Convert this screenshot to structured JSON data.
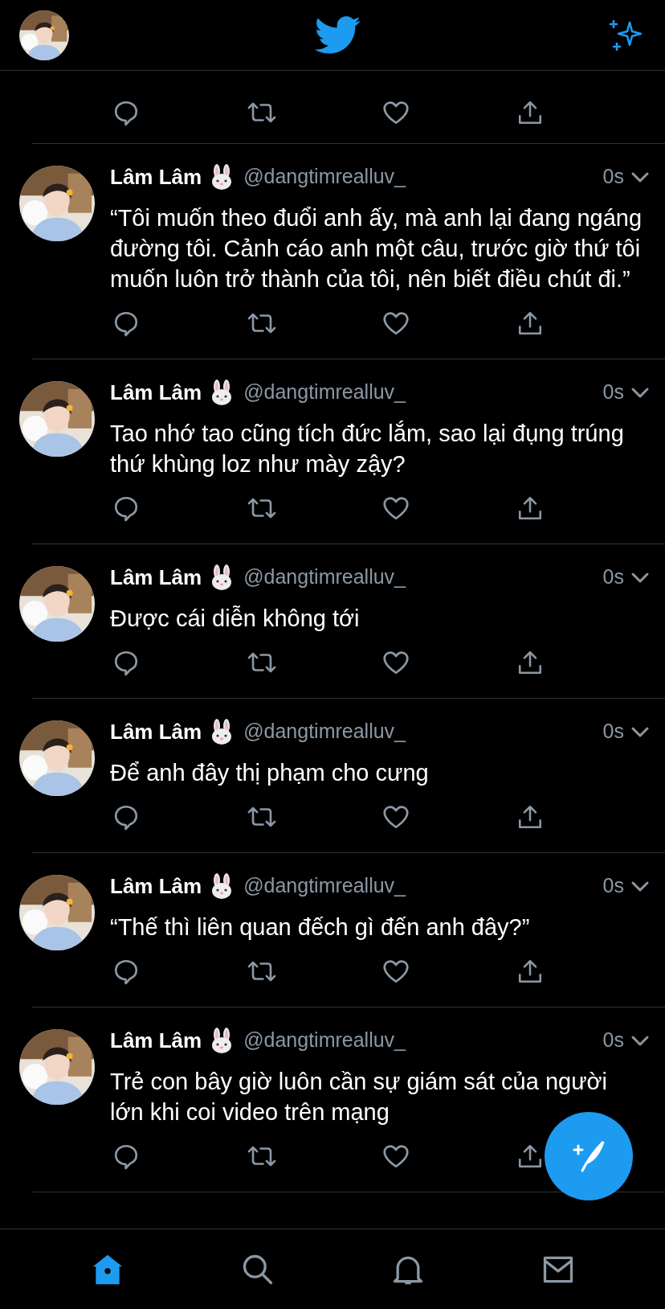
{
  "tweets": [
    {
      "kind": "cut_off"
    },
    {
      "kind": "full",
      "name": "Lâm Lâm",
      "handle": "@dangtimrealluv_",
      "time": "0s",
      "text": "“Tôi muốn theo đuổi anh ấy, mà anh lại đang ngáng đường tôi. Cảnh cáo anh một câu, trước giờ thứ tôi muốn luôn trở thành của tôi, nên biết điều chút đi.”"
    },
    {
      "kind": "full",
      "name": "Lâm Lâm",
      "handle": "@dangtimrealluv_",
      "time": "0s",
      "text": "Tao nhớ tao cũng tích đức lắm, sao lại đụng trúng thứ khùng loz như mày zậy?"
    },
    {
      "kind": "full",
      "name": "Lâm Lâm",
      "handle": "@dangtimrealluv_",
      "time": "0s",
      "text": "Được cái diễn không tới"
    },
    {
      "kind": "full",
      "name": "Lâm Lâm",
      "handle": "@dangtimrealluv_",
      "time": "0s",
      "text": "Để anh đây thị phạm cho cưng"
    },
    {
      "kind": "full",
      "name": "Lâm Lâm",
      "handle": "@dangtimrealluv_",
      "time": "0s",
      "text": "“Thế thì liên quan đếch gì đến anh đây?”"
    },
    {
      "kind": "full",
      "name": "Lâm Lâm",
      "handle": "@dangtimrealluv_",
      "time": "0s",
      "text": "Trẻ con bây giờ luôn cần sự giám sát của người lớn khi coi video trên mạng"
    }
  ],
  "tab_bar": [
    {
      "selected": true
    },
    {
      "selected": false
    },
    {
      "selected": false
    },
    {
      "selected": false
    }
  ]
}
